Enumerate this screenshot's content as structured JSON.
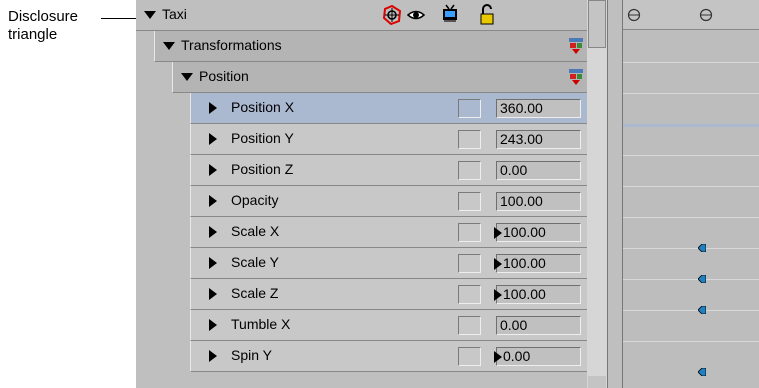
{
  "callout": {
    "line1": "Disclosure",
    "line2": "triangle"
  },
  "layers": {
    "object_label": "Taxi",
    "group_label": "Transformations",
    "subgroup_label": "Position"
  },
  "properties": [
    {
      "label": "Position X",
      "value": "360.00",
      "keyframed": false,
      "selected": true
    },
    {
      "label": "Position Y",
      "value": "243.00",
      "keyframed": false,
      "selected": false
    },
    {
      "label": "Position Z",
      "value": "0.00",
      "keyframed": false,
      "selected": false
    },
    {
      "label": "Opacity",
      "value": "100.00",
      "keyframed": false,
      "selected": false
    },
    {
      "label": "Scale X",
      "value": "100.00",
      "keyframed": true,
      "selected": false
    },
    {
      "label": "Scale Y",
      "value": "100.00",
      "keyframed": true,
      "selected": false
    },
    {
      "label": "Scale Z",
      "value": "100.00",
      "keyframed": true,
      "selected": false
    },
    {
      "label": "Tumble X",
      "value": "0.00",
      "keyframed": false,
      "selected": false
    },
    {
      "label": "Spin Y",
      "value": "0.00",
      "keyframed": true,
      "selected": false
    }
  ],
  "icons": {
    "row_icons": [
      "target-icon",
      "eye-icon",
      "monitor-icon",
      "lock-icon"
    ],
    "reset_icon": "reset-icon",
    "keyframe_icon": "keyframe-icon"
  },
  "colors": {
    "selection": "#aab8d0",
    "keyframe": "#2080c0"
  }
}
